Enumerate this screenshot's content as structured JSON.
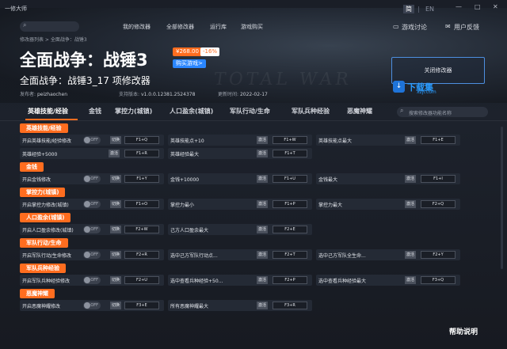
{
  "window": {
    "app_title": "一修大师",
    "lang_cn": "简",
    "lang_sep": "|",
    "lang_en": "EN",
    "min": "—",
    "max": "□",
    "close": "✕"
  },
  "nav": {
    "items": [
      "我的修改器",
      "全部修改器",
      "运行库",
      "游戏购买"
    ],
    "discuss": "游戏讨论",
    "feedback": "用户反馈",
    "discuss_icon": "chat-icon",
    "feedback_icon": "mail-icon"
  },
  "breadcrumb": "修改器列表 > 全面战争：战锤3",
  "game": {
    "title": "全面战争：战锤3",
    "price": "¥268.00",
    "discount": "-16%",
    "buy": "购买游戏>",
    "subtitle": "全面战争：战锤3_17 项修改器",
    "publisher_label": "发布者:",
    "publisher": "peizhaochen",
    "version_label": "支持版本:",
    "version": "v1.0.0.12381.2524378",
    "updated_label": "更新时间:",
    "updated": "2022-02-17",
    "close_trainer": "关闭修改器",
    "bg_text": "TOTAL WAR"
  },
  "watermark": {
    "text": "下载集",
    "sub": "xzji.com",
    "logo": "↓"
  },
  "tabs": [
    "英雄技能/经验",
    "金钱",
    "掌控力(城镇)",
    "人口盈余(城镇)",
    "军队行动/生命",
    "军队兵种经验",
    "恶魔神耀"
  ],
  "tab_search_placeholder": "搜索修改器功能名称",
  "categories": [
    {
      "name": "英雄技能/经验",
      "rows": [
        [
          {
            "label": "开启英雄技能/经验修改",
            "toggle": "OFF",
            "act": "切换",
            "key": "F1+Q"
          },
          {
            "label": "英雄技能点+10",
            "act": "激活",
            "key": "F1+W"
          },
          {
            "label": "英雄技能点最大",
            "act": "激活",
            "key": "F1+E"
          }
        ],
        [
          {
            "label": "英雄经验+5000",
            "act": "激活",
            "key": "F1+R"
          },
          {
            "label": "英雄经验最大",
            "act": "激活",
            "key": "F1+T"
          }
        ]
      ]
    },
    {
      "name": "金钱",
      "rows": [
        [
          {
            "label": "开启金钱修改",
            "toggle": "OFF",
            "act": "切换",
            "key": "F1+Y"
          },
          {
            "label": "金钱+10000",
            "act": "激活",
            "key": "F1+U"
          },
          {
            "label": "金钱最大",
            "act": "激活",
            "key": "F1+I"
          }
        ]
      ]
    },
    {
      "name": "掌控力(城镇)",
      "rows": [
        [
          {
            "label": "开启掌控力修改(城镇)",
            "toggle": "OFF",
            "act": "切换",
            "key": "F1+O"
          },
          {
            "label": "掌控力最小",
            "act": "激活",
            "key": "F1+P"
          },
          {
            "label": "掌控力最大",
            "act": "激活",
            "key": "F2+Q"
          }
        ]
      ]
    },
    {
      "name": "人口盈余(城镇)",
      "rows": [
        [
          {
            "label": "开启人口盈余修改(城镇)",
            "toggle": "OFF",
            "act": "切换",
            "key": "F2+W"
          },
          {
            "label": "己方人口盈余最大",
            "act": "激活",
            "key": "F2+E"
          }
        ]
      ]
    },
    {
      "name": "军队行动/生命",
      "rows": [
        [
          {
            "label": "开启军队行动/生命修改",
            "toggle": "OFF",
            "act": "切换",
            "key": "F2+R"
          },
          {
            "label": "选中己方军队行动点...",
            "act": "激活",
            "key": "F2+T"
          },
          {
            "label": "选中己方军队全生命...",
            "act": "激活",
            "key": "F2+Y"
          }
        ]
      ]
    },
    {
      "name": "军队兵种经验",
      "rows": [
        [
          {
            "label": "开启军队兵种经验修改",
            "toggle": "OFF",
            "act": "切换",
            "key": "F2+U"
          },
          {
            "label": "选中查看兵种经验+50...",
            "act": "激活",
            "key": "F2+P"
          },
          {
            "label": "选中查看兵种经验最大",
            "act": "激活",
            "key": "F3+Q"
          }
        ]
      ]
    },
    {
      "name": "恶魔神耀",
      "rows": [
        [
          {
            "label": "开启恶魔神耀修改",
            "toggle": "OFF",
            "act": "切换",
            "key": "F3+E"
          },
          {
            "label": "所有恶魔神耀最大",
            "act": "激活",
            "key": "F3+R"
          }
        ]
      ]
    }
  ],
  "help": "帮助说明",
  "colors": {
    "accent": "#ff6d1f",
    "buy": "#2a86ff",
    "panel": "#242a35",
    "watermark": "#2a9cff"
  }
}
